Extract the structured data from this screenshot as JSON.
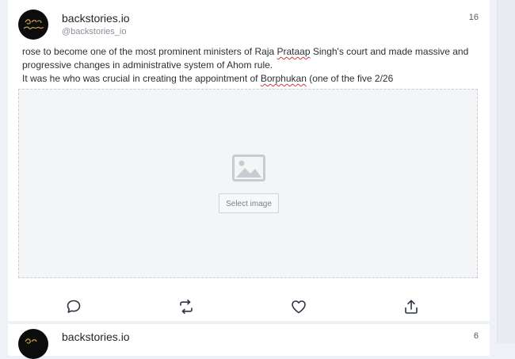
{
  "posts": [
    {
      "account_name": "backstories.io",
      "handle": "@backstories_io",
      "count": "16",
      "text": {
        "line1_a": "rose to become one of the most prominent ministers of Raja ",
        "line1_spell": "Prataap",
        "line1_b": " Singh's court and made massive and",
        "line2": "progressive changes in administrative system of Ahom rule.",
        "line3_a": "It was he who was crucial in creating the appointment of ",
        "line3_spell": "Borphukan",
        "line3_b": " (one of the five 2/26"
      },
      "media": {
        "select_label": "Select image",
        "icon": "image-placeholder-icon"
      },
      "actions": [
        {
          "name": "reply",
          "icon": "comment-icon"
        },
        {
          "name": "retweet",
          "icon": "retweet-icon"
        },
        {
          "name": "like",
          "icon": "heart-icon"
        },
        {
          "name": "share",
          "icon": "share-icon"
        }
      ]
    },
    {
      "account_name": "backstories.io",
      "count": "6"
    }
  ],
  "colors": {
    "avatar_bg": "#0c0c0c",
    "avatar_logo": "#c9a24a",
    "icon": "#2b3440",
    "spellcheck": "#d23a3a"
  }
}
